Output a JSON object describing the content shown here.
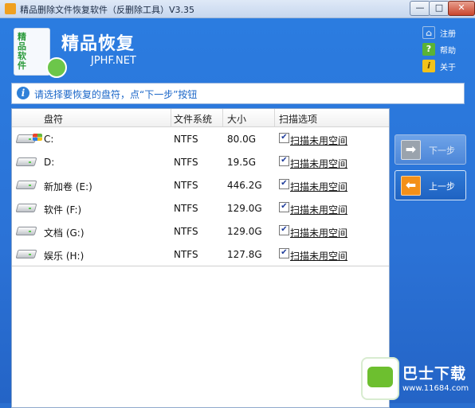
{
  "window": {
    "title": "精品删除文件恢复软件（反删除工具）V3.35",
    "min": "—",
    "max": "□",
    "close": "✕"
  },
  "header": {
    "logo_text": "精品软件",
    "title": "精品恢复",
    "url": "JPHF.NET"
  },
  "side_links": [
    {
      "label": "注册",
      "icon": "cart-icon",
      "glyph": "⌂"
    },
    {
      "label": "帮助",
      "icon": "help-icon",
      "glyph": "?"
    },
    {
      "label": "关于",
      "icon": "about-icon",
      "glyph": "i"
    }
  ],
  "info": {
    "icon_glyph": "i",
    "text": "请选择要恢复的盘符，点“下一步”按钮"
  },
  "table": {
    "columns": [
      "盘符",
      "文件系统",
      "大小",
      "扫描选项"
    ],
    "rows": [
      {
        "drive": "C:",
        "fs": "NTFS",
        "size": "80.0G",
        "option": "扫描未用空间",
        "checked": true,
        "system": true
      },
      {
        "drive": "D:",
        "fs": "NTFS",
        "size": "19.5G",
        "option": "扫描未用空间",
        "checked": true,
        "system": false
      },
      {
        "drive": "新加卷 (E:)",
        "fs": "NTFS",
        "size": "446.2G",
        "option": "扫描未用空间",
        "checked": true,
        "system": false
      },
      {
        "drive": "软件 (F:)",
        "fs": "NTFS",
        "size": "129.0G",
        "option": "扫描未用空间",
        "checked": true,
        "system": false
      },
      {
        "drive": "文档 (G:)",
        "fs": "NTFS",
        "size": "129.0G",
        "option": "扫描未用空间",
        "checked": true,
        "system": false
      },
      {
        "drive": "娱乐 (H:)",
        "fs": "NTFS",
        "size": "127.8G",
        "option": "扫描未用空间",
        "checked": true,
        "system": false
      }
    ],
    "check_glyph": "✔"
  },
  "buttons": {
    "next": {
      "label": "下一步",
      "glyph": "➡"
    },
    "prev": {
      "label": "上一步",
      "glyph": "⬅"
    }
  },
  "watermark": {
    "title": "巴士下载",
    "url": "www.11684.com"
  },
  "colors": {
    "client_bg": "#2b72d6",
    "accent_link": "#1a66c8",
    "next_btn": "#4c86d8",
    "prev_btn": "#1f63c2",
    "prev_icon": "#f39019"
  }
}
